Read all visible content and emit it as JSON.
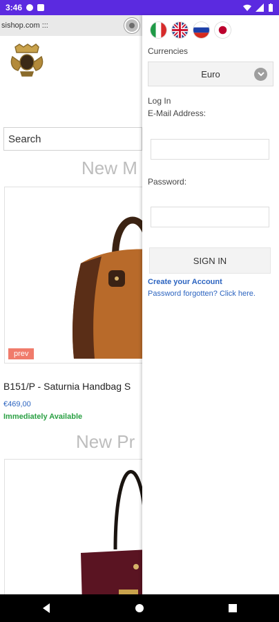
{
  "status_bar": {
    "time": "3:46"
  },
  "browser": {
    "url_fragment": "sishop.com :::"
  },
  "page": {
    "search_placeholder": "Search",
    "section1_title": "New M",
    "section2_title": "New Pr",
    "product": {
      "title": "B151/P - Saturnia Handbag S",
      "price": "€469,00",
      "availability": "Immediately Available",
      "badge": "prev"
    },
    "colors": {
      "price": "#2c64c0",
      "available": "#2aa043",
      "badge": "#f07b6b"
    }
  },
  "drawer": {
    "languages": [
      "italian-flag-icon",
      "uk-flag-icon",
      "russian-flag-icon",
      "japanese-flag-icon"
    ],
    "currencies_label": "Currencies",
    "currency_selected": "Euro",
    "login_label": "Log In",
    "email_label": "E-Mail Address:",
    "password_label": "Password:",
    "signin_button": "SIGN IN",
    "create_account": "Create your Account",
    "forgot_password": "Password forgotten? Click here."
  },
  "theme": {
    "status_bar_color": "#5b2ae0"
  }
}
